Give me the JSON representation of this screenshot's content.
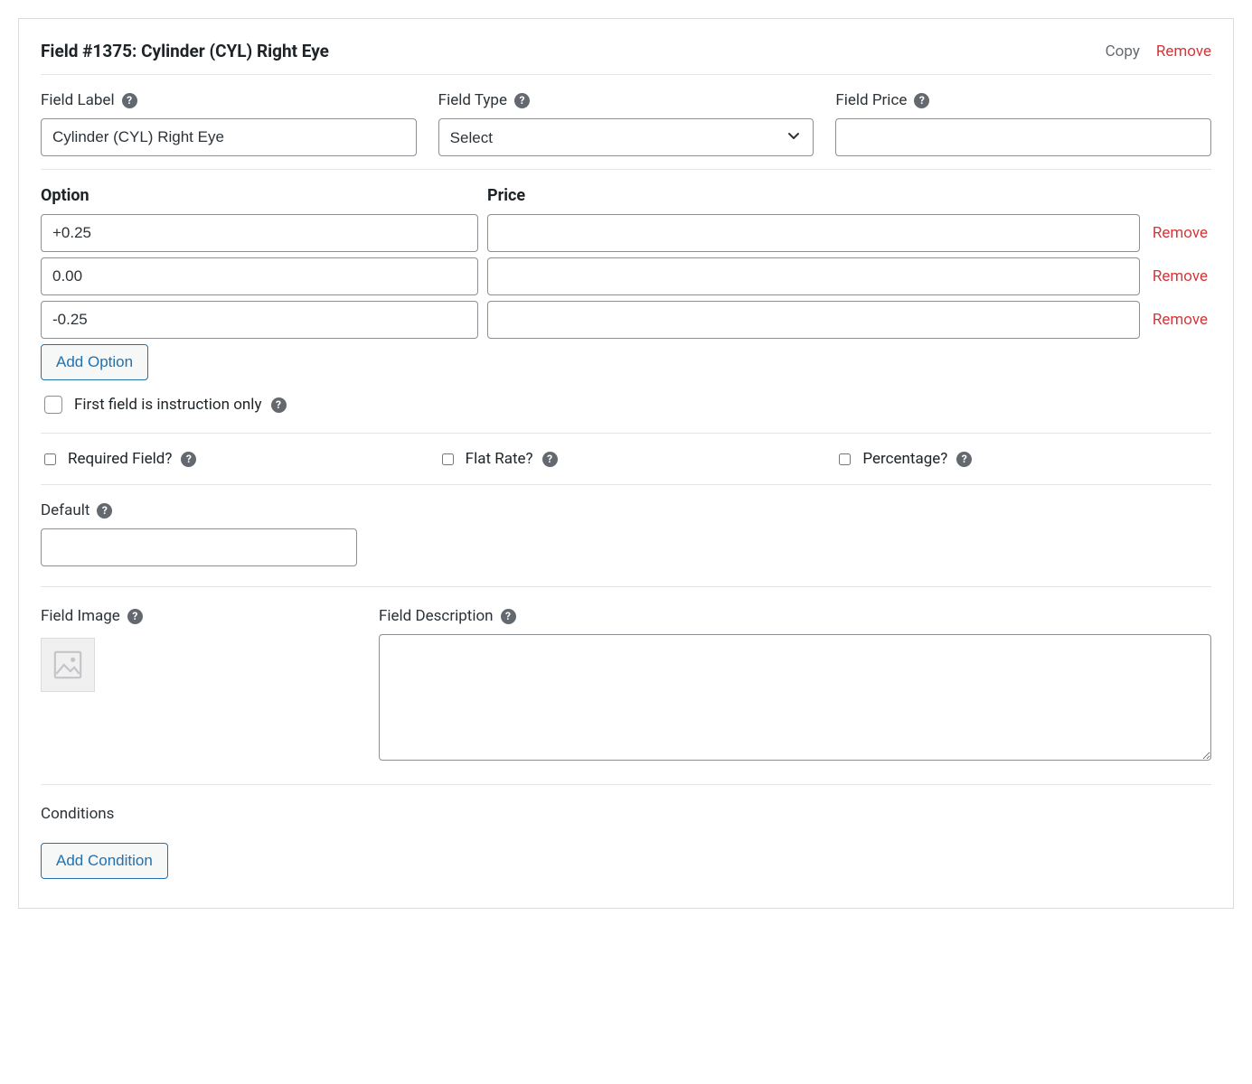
{
  "header": {
    "title": "Field #1375: Cylinder (CYL) Right Eye",
    "copy_label": "Copy",
    "remove_label": "Remove"
  },
  "labels": {
    "field_label": "Field Label",
    "field_type": "Field Type",
    "field_price": "Field Price",
    "option": "Option",
    "price": "Price",
    "add_option": "Add Option",
    "first_instruction": "First field is instruction only",
    "required": "Required Field?",
    "flat_rate": "Flat Rate?",
    "percentage": "Percentage?",
    "default": "Default",
    "field_image": "Field Image",
    "field_description": "Field Description",
    "conditions": "Conditions",
    "add_condition": "Add Condition",
    "remove": "Remove"
  },
  "values": {
    "field_label": "Cylinder (CYL) Right Eye",
    "field_type": "Select",
    "field_price": "",
    "default": "",
    "description": ""
  },
  "options": [
    {
      "option": "+0.25",
      "price": ""
    },
    {
      "option": "0.00",
      "price": ""
    },
    {
      "option": "-0.25",
      "price": ""
    }
  ]
}
